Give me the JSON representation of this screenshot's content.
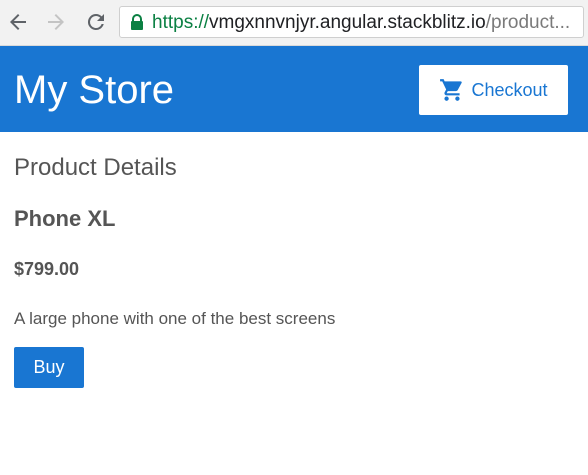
{
  "browser": {
    "url_scheme": "https://",
    "url_host": "vmgxnnvnjyr.angular.stackblitz.io",
    "url_path": "/product...",
    "icons": [
      "back-icon",
      "forward-icon",
      "reload-icon",
      "lock-icon"
    ]
  },
  "header": {
    "title": "My Store",
    "checkout_label": "Checkout",
    "checkout_icon": "shopping-cart-icon"
  },
  "main": {
    "heading": "Product Details",
    "product": {
      "name": "Phone XL",
      "price": "$799.00",
      "description": "A large phone with one of the best screens"
    },
    "buy_label": "Buy"
  },
  "colors": {
    "primary": "#1976d2",
    "text": "#555555",
    "url_secure": "#0b8043"
  }
}
